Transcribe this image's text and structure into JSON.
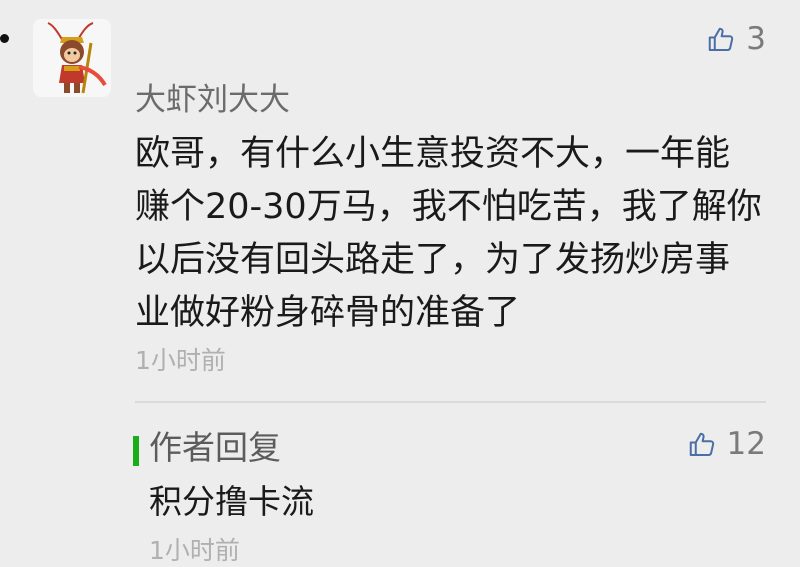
{
  "comment": {
    "nickname": "大虾刘大大",
    "likes": "3",
    "lines": [
      "欧哥，有什么小生意投资不大，一年能",
      "赚个20-30万马，我不怕吃苦，我了解你",
      "以后没有回头路走了，为了发扬炒房事",
      "业做好粉身碎骨的准备了"
    ],
    "time": "1小时前"
  },
  "author_reply": {
    "label": "作者回复",
    "likes": "12",
    "text": "积分撸卡流",
    "time": "1小时前"
  },
  "icons": {
    "avatar": "monkey-king-avatar",
    "like": "thumbs-up-icon"
  },
  "colors": {
    "background": "#ededed",
    "reply_accent": "#1aad19"
  }
}
